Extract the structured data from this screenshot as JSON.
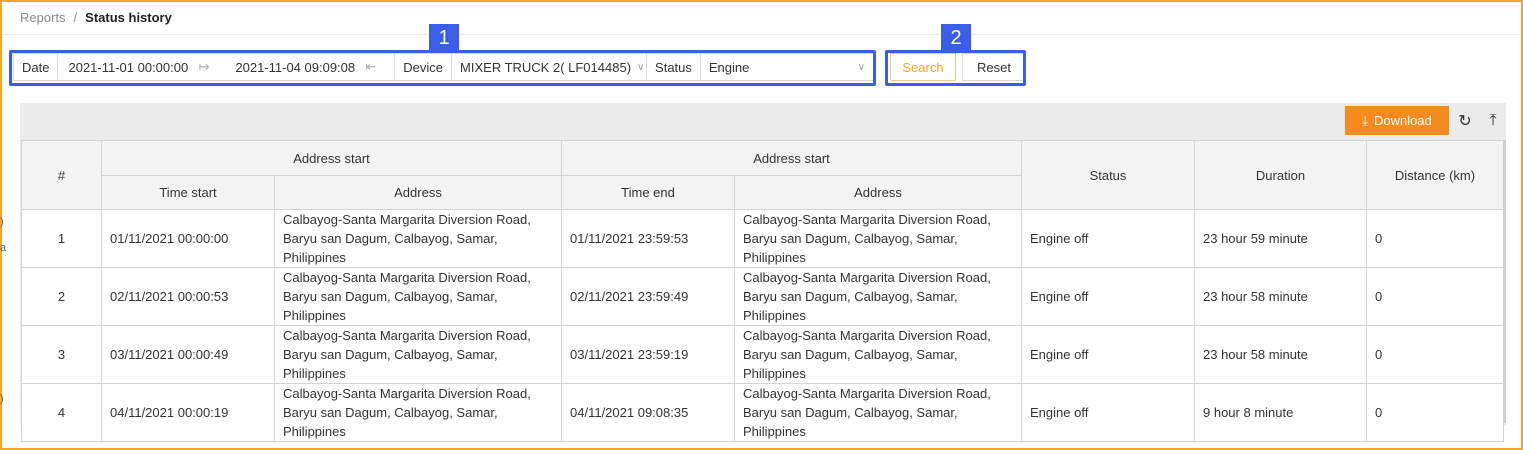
{
  "breadcrumb": {
    "parent": "Reports",
    "separator": "/",
    "current": "Status history"
  },
  "filters": {
    "date_label": "Date",
    "date_from": "2021-11-01 00:00:00",
    "date_to": "2021-11-04 09:09:08",
    "device_label": "Device",
    "device_value": "MIXER TRUCK 2( LF014485)",
    "status_label": "Status",
    "status_value": "Engine"
  },
  "buttons": {
    "search": "Search",
    "reset": "Reset",
    "download": "Download"
  },
  "callouts": [
    "1",
    "2"
  ],
  "table": {
    "headers": {
      "num": "#",
      "group_start": "Address start",
      "group_end": "Address start",
      "time_start": "Time start",
      "address_start": "Address",
      "time_end": "Time end",
      "address_end": "Address",
      "status": "Status",
      "duration": "Duration",
      "distance": "Distance (km)"
    },
    "rows": [
      {
        "num": "1",
        "time_start": "01/11/2021 00:00:00",
        "address_start": "Calbayog-Santa Margarita Diversion Road, Baryu san Dagum, Calbayog, Samar, Philippines",
        "time_end": "01/11/2021 23:59:53",
        "address_end": "Calbayog-Santa Margarita Diversion Road, Baryu san Dagum, Calbayog, Samar, Philippines",
        "status": "Engine off",
        "duration": "23 hour 59 minute",
        "distance": "0"
      },
      {
        "num": "2",
        "time_start": "02/11/2021 00:00:53",
        "address_start": "Calbayog-Santa Margarita Diversion Road, Baryu san Dagum, Calbayog, Samar, Philippines",
        "time_end": "02/11/2021 23:59:49",
        "address_end": "Calbayog-Santa Margarita Diversion Road, Baryu san Dagum, Calbayog, Samar, Philippines",
        "status": "Engine off",
        "duration": "23 hour 58 minute",
        "distance": "0"
      },
      {
        "num": "3",
        "time_start": "03/11/2021 00:00:49",
        "address_start": "Calbayog-Santa Margarita Diversion Road, Baryu san Dagum, Calbayog, Samar, Philippines",
        "time_end": "03/11/2021 23:59:19",
        "address_end": "Calbayog-Santa Margarita Diversion Road, Baryu san Dagum, Calbayog, Samar, Philippines",
        "status": "Engine off",
        "duration": "23 hour 58 minute",
        "distance": "0"
      },
      {
        "num": "4",
        "time_start": "04/11/2021 00:00:19",
        "address_start": "Calbayog-Santa Margarita Diversion Road, Baryu san Dagum, Calbayog, Samar, Philippines",
        "time_end": "04/11/2021 09:08:35",
        "address_end": "Calbayog-Santa Margarita Diversion Road, Baryu san Dagum, Calbayog, Samar, Philippines",
        "status": "Engine off",
        "duration": "9 hour 8 minute",
        "distance": "0"
      }
    ]
  },
  "icons": {
    "date_arrow": "arrow-right-to-bar-icon",
    "date_clear": "arrow-left-to-bar-icon",
    "select_chevron": "chevron-down-icon",
    "download": "download-icon",
    "refresh": "refresh-icon",
    "column_height": "column-height-icon"
  },
  "colors": {
    "frame_border": "#f5a623",
    "callout_blue": "#3a5ee8",
    "download_bg": "#f58a1f",
    "search_text": "#f5a623"
  }
}
